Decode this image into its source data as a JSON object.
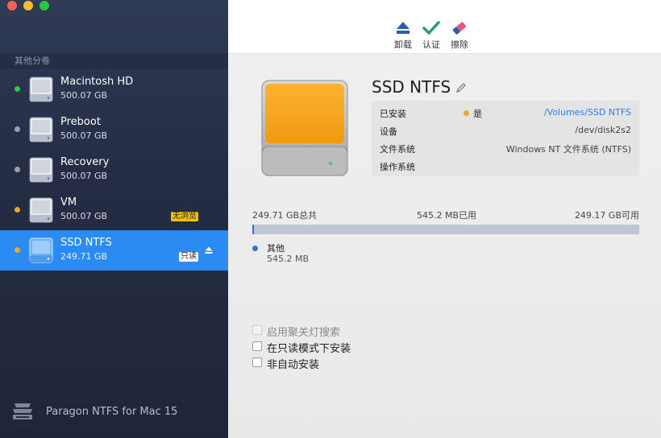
{
  "sidebar": {
    "section_label": "其他分卷",
    "volumes": [
      {
        "name": "Macintosh HD",
        "size": "500.07 GB",
        "status_color": "#2fc94a",
        "badge": ""
      },
      {
        "name": "Preboot",
        "size": "500.07 GB",
        "status_color": "#9aa0ad",
        "badge": ""
      },
      {
        "name": "Recovery",
        "size": "500.07 GB",
        "status_color": "#9aa0ad",
        "badge": ""
      },
      {
        "name": "VM",
        "size": "500.07 GB",
        "status_color": "#f5a524",
        "badge": "无浏览"
      },
      {
        "name": "SSD NTFS",
        "size": "249.71 GB",
        "status_color": "#f5a524",
        "badge": "只读",
        "selected": true
      }
    ],
    "footer": {
      "app_name": "Paragon NTFS for Mac 15",
      "icon": "paragon-logo-icon"
    }
  },
  "toolbar": {
    "unmount_label": "卸载",
    "verify_label": "认证",
    "erase_label": "擦除"
  },
  "detail": {
    "title": "SSD NTFS",
    "info": {
      "mounted_key": "已安装",
      "mounted_status": "是",
      "mount_path": "/Volumes/SSD NTFS",
      "device_key": "设备",
      "device_value": "/dev/disk2s2",
      "fs_key": "文件系统",
      "fs_value": "Windows NT 文件系统 (NTFS)",
      "os_key": "操作系统",
      "os_value": ""
    },
    "usage": {
      "total_label": "249.71 GB总共",
      "used_label": "545.2 MB已用",
      "free_label": "249.17 GB可用",
      "used_fraction": 0.0022,
      "legend_name": "其他",
      "legend_size": "545.2 MB",
      "used_color": "#3c6fd1",
      "free_color": "#bfc6d3"
    },
    "options": [
      {
        "label": "启用聚关灯搜索",
        "checked": false,
        "disabled": true
      },
      {
        "label": "在只读模式下安装",
        "checked": false,
        "disabled": false
      },
      {
        "label": "非自动安装",
        "checked": false,
        "disabled": false
      }
    ]
  },
  "colors": {
    "accent": "#2b8bf2",
    "sidebar_bg": "#252d45",
    "mounted": "#f5a524"
  }
}
